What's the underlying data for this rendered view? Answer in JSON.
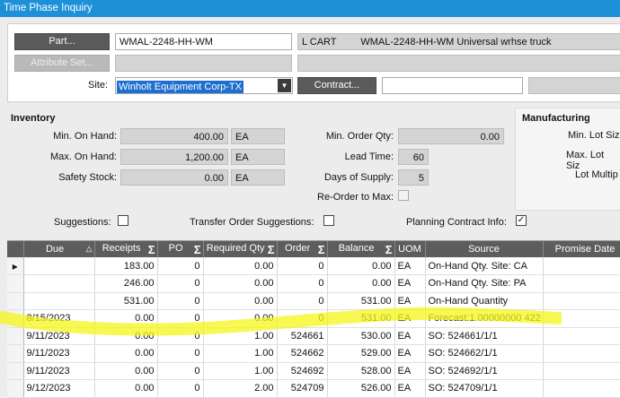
{
  "window": {
    "title": "Time Phase Inquiry"
  },
  "header": {
    "part_button": "Part...",
    "part_value": "WMAL-2248-HH-WM",
    "part_class": "L CART",
    "part_description": "WMAL-2248-HH-WM Universal wrhse truck",
    "attribute_button": "Attribute Set...",
    "site_label": "Site:",
    "site_value": "Winholt Equipment Corp-TX",
    "contract_button": "Contract...",
    "contract_value": ""
  },
  "inventory": {
    "title": "Inventory",
    "min_on_hand_label": "Min. On Hand:",
    "min_on_hand": "400.00",
    "min_on_hand_uom": "EA",
    "max_on_hand_label": "Max. On Hand:",
    "max_on_hand": "1,200.00",
    "max_on_hand_uom": "EA",
    "safety_stock_label": "Safety Stock:",
    "safety_stock": "0.00",
    "safety_stock_uom": "EA",
    "min_order_qty_label": "Min. Order Qty:",
    "min_order_qty": "0.00",
    "lead_time_label": "Lead Time:",
    "lead_time": "60",
    "days_of_supply_label": "Days of Supply:",
    "days_of_supply": "5",
    "reorder_to_max_label": "Re-Order to Max:"
  },
  "manufacturing": {
    "title": "Manufacturing",
    "min_lot_label": "Min. Lot Siz",
    "max_lot_label": "Max. Lot Siz",
    "lot_multiple_label": "Lot Multip"
  },
  "options": {
    "suggestions_label": "Suggestions:",
    "suggestions_checked": false,
    "transfer_label": "Transfer Order Suggestions:",
    "transfer_checked": false,
    "planning_label": "Planning Contract Info:",
    "planning_checked": true
  },
  "grid": {
    "columns": [
      "Due",
      "Receipts",
      "PO",
      "Required Qty",
      "Order",
      "Balance",
      "UOM",
      "Source",
      "Promise Date"
    ],
    "rows": [
      {
        "due": "",
        "receipts": "183.00",
        "po": "0",
        "required": "0.00",
        "order": "0",
        "balance": "0.00",
        "uom": "EA",
        "source": "On-Hand Qty. Site: CA",
        "promise": ""
      },
      {
        "due": "",
        "receipts": "246.00",
        "po": "0",
        "required": "0.00",
        "order": "0",
        "balance": "0.00",
        "uom": "EA",
        "source": "On-Hand Qty. Site: PA",
        "promise": ""
      },
      {
        "due": "",
        "receipts": "531.00",
        "po": "0",
        "required": "0.00",
        "order": "0",
        "balance": "531.00",
        "uom": "EA",
        "source": "On-Hand Quantity",
        "promise": ""
      },
      {
        "due": "8/15/2023",
        "receipts": "0.00",
        "po": "0",
        "required": "0.00",
        "order": "0",
        "balance": "531.00",
        "uom": "EA",
        "source": "Forecast:1.00000000 422",
        "promise": ""
      },
      {
        "due": "9/11/2023",
        "receipts": "0.00",
        "po": "0",
        "required": "1.00",
        "order": "524661",
        "balance": "530.00",
        "uom": "EA",
        "source": "SO: 524661/1/1",
        "promise": ""
      },
      {
        "due": "9/11/2023",
        "receipts": "0.00",
        "po": "0",
        "required": "1.00",
        "order": "524662",
        "balance": "529.00",
        "uom": "EA",
        "source": "SO: 524662/1/1",
        "promise": ""
      },
      {
        "due": "9/11/2023",
        "receipts": "0.00",
        "po": "0",
        "required": "1.00",
        "order": "524692",
        "balance": "528.00",
        "uom": "EA",
        "source": "SO: 524692/1/1",
        "promise": ""
      },
      {
        "due": "9/12/2023",
        "receipts": "0.00",
        "po": "0",
        "required": "2.00",
        "order": "524709",
        "balance": "526.00",
        "uom": "EA",
        "source": "SO: 524709/1/1",
        "promise": ""
      }
    ]
  },
  "colors": {
    "title_bar": "#1e90d8",
    "highlight": "#f5f51a",
    "header_bg": "#5d5d5d"
  }
}
